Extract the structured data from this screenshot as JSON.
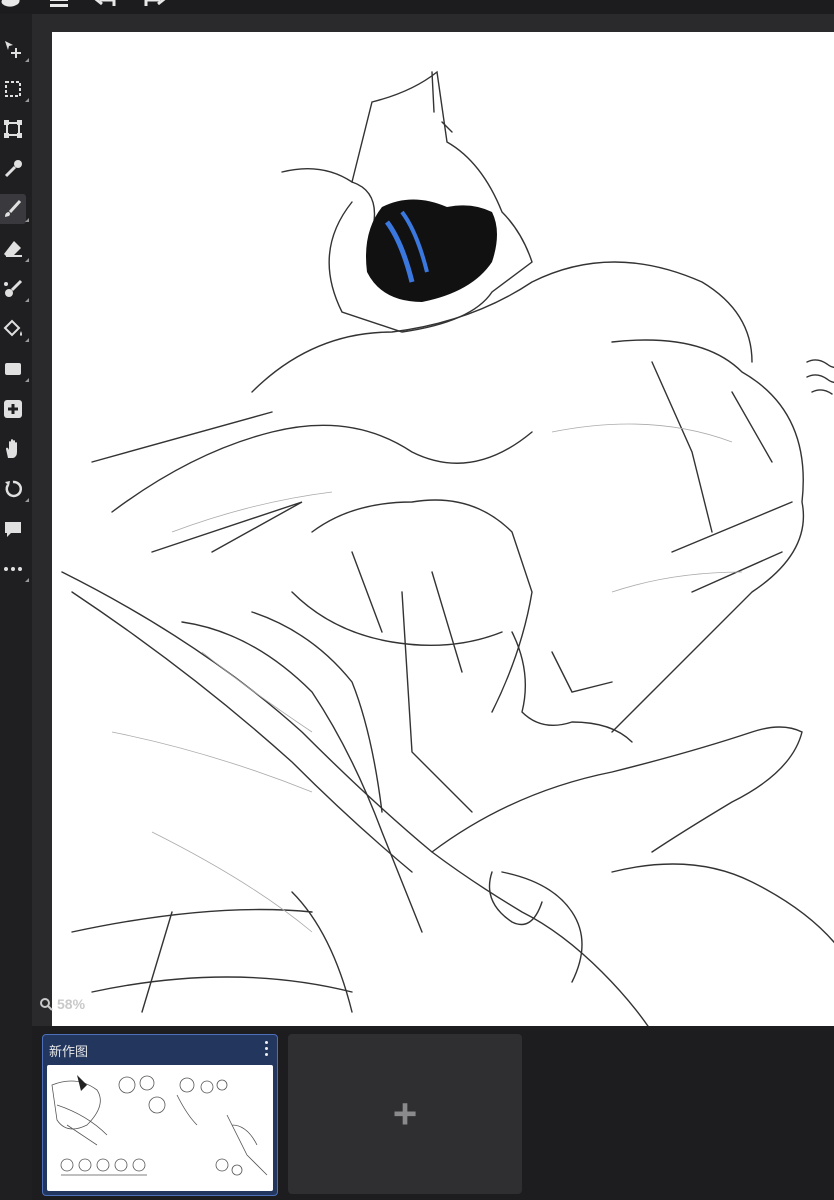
{
  "toolbar": {
    "tools": [
      {
        "name": "move-tool",
        "icon": "move-icon"
      },
      {
        "name": "select-tool",
        "icon": "selection-icon"
      },
      {
        "name": "transform-tool",
        "icon": "transform-icon"
      },
      {
        "name": "eyedropper-tool",
        "icon": "eyedropper-icon"
      },
      {
        "name": "brush-tool",
        "icon": "brush-icon",
        "active": true
      },
      {
        "name": "eraser-tool",
        "icon": "eraser-icon"
      },
      {
        "name": "smudge-tool",
        "icon": "smudge-icon"
      },
      {
        "name": "fill-tool",
        "icon": "fill-bucket-icon"
      },
      {
        "name": "shape-tool",
        "icon": "rectangle-icon"
      },
      {
        "name": "add-layer-tool",
        "icon": "plus-square-icon"
      },
      {
        "name": "hand-tool",
        "icon": "hand-icon"
      },
      {
        "name": "rotate-tool",
        "icon": "rotate-icon"
      },
      {
        "name": "comment-tool",
        "icon": "speech-bubble-icon"
      },
      {
        "name": "more-tools",
        "icon": "more-icon"
      }
    ]
  },
  "zoom": {
    "label": "58%"
  },
  "gallery": {
    "items": [
      {
        "title": "新作图"
      }
    ],
    "new_label": "+"
  },
  "colors": {
    "accent": "#4b6fb8",
    "card_bg": "#23365e",
    "blue_stroke": "#3a78e0"
  }
}
